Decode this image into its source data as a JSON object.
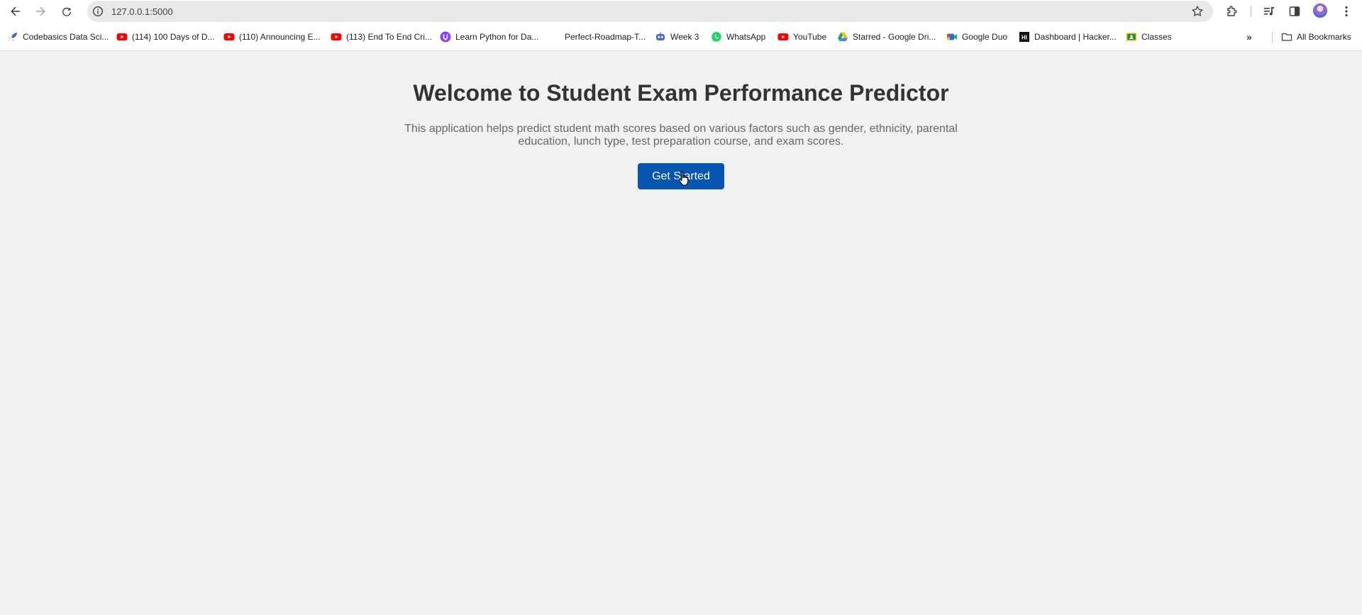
{
  "browser": {
    "url": "127.0.0.1:5000",
    "icons": {
      "back": "back-arrow-icon",
      "forward": "forward-arrow-icon",
      "reload": "reload-icon",
      "site_info": "info-icon",
      "bookmark_star": "star-icon",
      "extensions": "puzzle-icon",
      "media": "media-control-icon",
      "side_panel": "side-panel-icon",
      "profile": "avatar",
      "menu": "kebab-menu-icon"
    }
  },
  "bookmarks": {
    "items": [
      {
        "label": "Codebasics Data Sci...",
        "icon": "rocket-icon"
      },
      {
        "label": "(114) 100 Days of D...",
        "icon": "youtube-icon"
      },
      {
        "label": "(110) Announcing E...",
        "icon": "youtube-icon"
      },
      {
        "label": "(113) End To End Cri...",
        "icon": "youtube-icon"
      },
      {
        "label": "Learn Python for Da...",
        "icon": "purple-logo-icon"
      },
      {
        "label": "Perfect-Roadmap-T...",
        "icon": ""
      },
      {
        "label": "Week 3",
        "icon": "robot-icon"
      },
      {
        "label": "WhatsApp",
        "icon": "whatsapp-icon"
      },
      {
        "label": "YouTube",
        "icon": "youtube-icon"
      },
      {
        "label": "Starred - Google Dri...",
        "icon": "google-drive-icon"
      },
      {
        "label": "Google Duo",
        "icon": "google-duo-icon"
      },
      {
        "label": "Dashboard | Hacker...",
        "icon": "hackerrank-icon"
      },
      {
        "label": "Classes",
        "icon": "classroom-icon"
      }
    ],
    "more": "»",
    "all_bookmarks": "All Bookmarks"
  },
  "page": {
    "title": "Welcome to Student Exam Performance Predictor",
    "description_line1": "This application helps predict student math scores based on various factors such as gender, ethnicity, parental",
    "description_line2": "education, lunch type, test preparation course, and exam scores.",
    "cta_label": "Get Started",
    "cta_color": "#0656b1"
  }
}
